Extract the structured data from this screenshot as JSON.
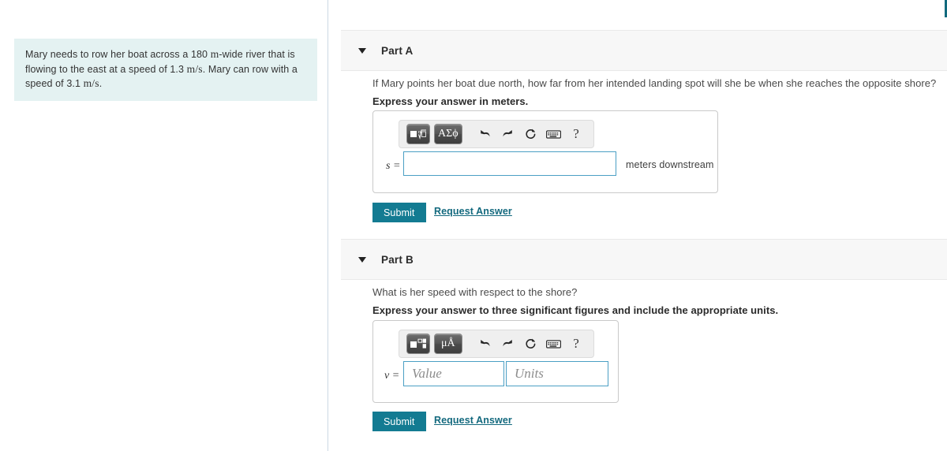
{
  "problem": {
    "text_segments": [
      {
        "t": "Mary needs to row her boat across a 180 ",
        "k": "plain"
      },
      {
        "t": "m",
        "k": "unit"
      },
      {
        "t": "-wide river that is flowing to the east at a speed of 1.3 ",
        "k": "plain"
      },
      {
        "t": "m/s",
        "k": "unit"
      },
      {
        "t": ". Mary can row with a speed of 3.1 ",
        "k": "plain"
      },
      {
        "t": "m/s",
        "k": "unit"
      },
      {
        "t": ".",
        "k": "plain"
      }
    ],
    "full_text": "Mary needs to row her boat across a 180 m-wide river that is flowing to the east at a speed of 1.3 m/s. Mary can row with a speed of 3.1 m/s.",
    "background_color": "#e4f2f2"
  },
  "colors": {
    "submit_teal": "#137b92",
    "link_teal": "#13697e",
    "input_border_blue": "#4b9fc4",
    "header_gray": "#f7f7f7",
    "divider_blue_gray": "#ccd8e4"
  },
  "parts": [
    {
      "id": "part-a",
      "title": "Part A",
      "caret_icon": "caret-down-icon",
      "question": "If Mary points her boat due north, how far from her intended landing spot will she be when she reaches the opposite shore?",
      "instruction": "Express your answer in meters.",
      "toolbar": {
        "buttons": [
          {
            "name": "math-template-root-button",
            "glyph": "√",
            "label": "nth-root-template"
          },
          {
            "name": "greek-symbols-button",
            "glyph": "ΑΣϕ",
            "label": "AΣφ"
          }
        ],
        "icons": [
          {
            "name": "undo-icon",
            "label": "undo"
          },
          {
            "name": "redo-icon",
            "label": "redo"
          },
          {
            "name": "reset-icon",
            "label": "reset"
          },
          {
            "name": "keyboard-icon",
            "label": "keyboard"
          },
          {
            "name": "help-icon",
            "label": "?"
          }
        ]
      },
      "variable_label": "s =",
      "input": {
        "value": "",
        "placeholder": ""
      },
      "unit_suffix": "meters downstream",
      "submit_label": "Submit",
      "request_answer_label": "Request Answer"
    },
    {
      "id": "part-b",
      "title": "Part B",
      "caret_icon": "caret-down-icon",
      "question": "What is her speed with respect to the shore?",
      "instruction": "Express your answer to three significant figures and include the appropriate units.",
      "toolbar": {
        "buttons": [
          {
            "name": "math-template-blocks-button",
            "glyph": "■",
            "label": "template-blocks"
          },
          {
            "name": "units-symbols-button",
            "glyph": "μÅ",
            "label": "μÅ"
          }
        ],
        "icons": [
          {
            "name": "undo-icon",
            "label": "undo"
          },
          {
            "name": "redo-icon",
            "label": "redo"
          },
          {
            "name": "reset-icon",
            "label": "reset"
          },
          {
            "name": "keyboard-icon",
            "label": "keyboard"
          },
          {
            "name": "help-icon",
            "label": "?"
          }
        ]
      },
      "variable_label": "v =",
      "value_input": {
        "value": "",
        "placeholder": "Value"
      },
      "units_input": {
        "value": "",
        "placeholder": "Units"
      },
      "submit_label": "Submit",
      "request_answer_label": "Request Answer"
    }
  ]
}
